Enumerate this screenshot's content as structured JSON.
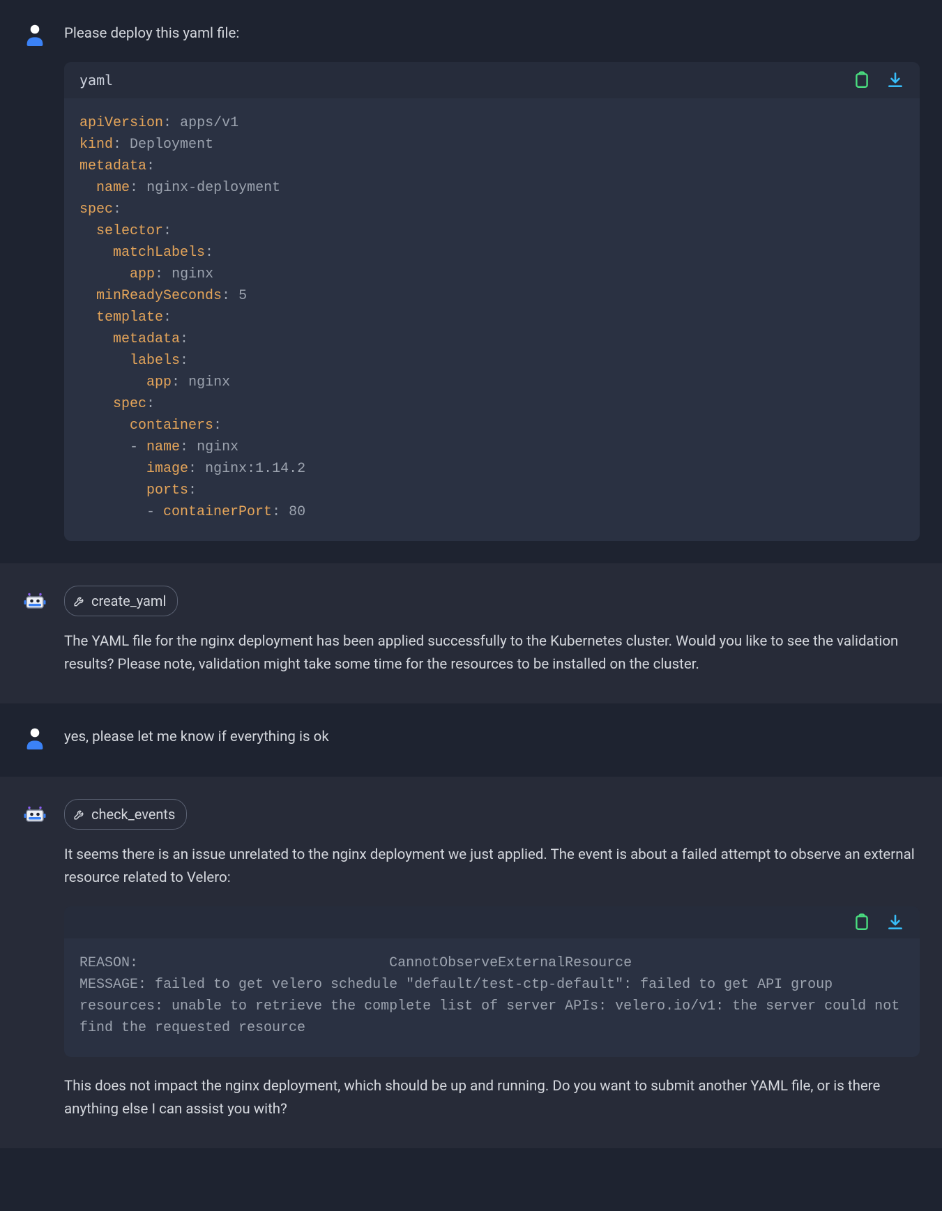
{
  "messages": {
    "m1": {
      "text": "Please deploy this yaml file:"
    },
    "m1_code": {
      "lang": "yaml",
      "lines": {
        "l1": {
          "k": "apiVersion",
          "v": "apps/v1"
        },
        "l2": {
          "k": "kind",
          "v": "Deployment"
        },
        "l3": {
          "k": "metadata"
        },
        "l4": {
          "k": "name",
          "v": "nginx-deployment"
        },
        "l5": {
          "k": "spec"
        },
        "l6": {
          "k": "selector"
        },
        "l7": {
          "k": "matchLabels"
        },
        "l8": {
          "k": "app",
          "v": "nginx"
        },
        "l9": {
          "k": "minReadySeconds",
          "v": "5"
        },
        "l10": {
          "k": "template"
        },
        "l11": {
          "k": "metadata"
        },
        "l12": {
          "k": "labels"
        },
        "l13": {
          "k": "app",
          "v": "nginx"
        },
        "l14": {
          "k": "spec"
        },
        "l15": {
          "k": "containers"
        },
        "l16": {
          "dash": "- ",
          "k": "name",
          "v": "nginx"
        },
        "l17": {
          "k": "image",
          "v": "nginx:1.14.2"
        },
        "l18": {
          "k": "ports"
        },
        "l19": {
          "dash": "- ",
          "k": "containerPort",
          "v": "80"
        }
      }
    },
    "m2": {
      "tool": "create_yaml",
      "text": "The YAML file for the nginx deployment has been applied successfully to the Kubernetes cluster. Would you like to see the validation results? Please note, validation might take some time for the resources to be installed on the cluster."
    },
    "m3": {
      "text": "yes, please let me know if everything is ok"
    },
    "m4": {
      "tool": "check_events",
      "text1": "It seems there is an issue unrelated to the nginx deployment we just applied. The event is about a failed attempt to observe an external resource related to Velero:",
      "code": "REASON:                              CannotObserveExternalResource\nMESSAGE: failed to get velero schedule \"default/test-ctp-default\": failed to get API group resources: unable to retrieve the complete list of server APIs: velero.io/v1: the server could not find the requested resource",
      "text2": "This does not impact the nginx deployment, which should be up and running. Do you want to submit another YAML file, or is there anything else I can assist you with?"
    }
  }
}
